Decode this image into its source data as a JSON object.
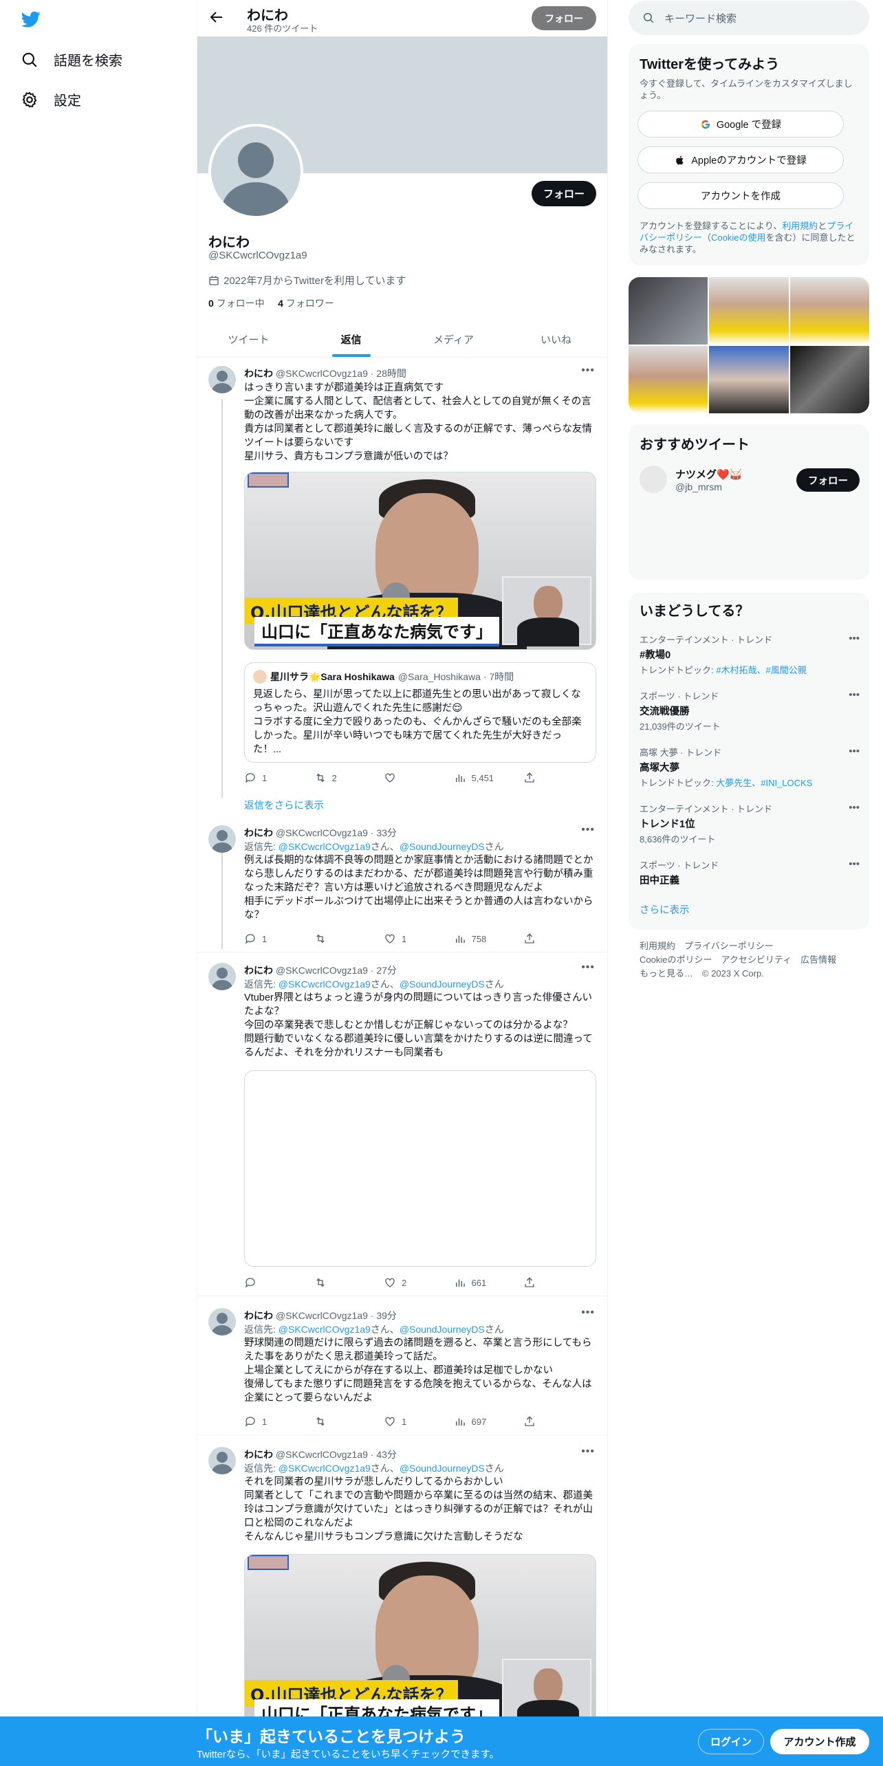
{
  "nav": {
    "explore_label": "話題を検索",
    "settings_label": "設定"
  },
  "header": {
    "name": "わにわ",
    "tweet_count": "426 件のツイート",
    "follow_label": "フォロー"
  },
  "profile": {
    "name": "わにわ",
    "handle": "@SKCwcrlCOvgz1a9",
    "joined": "2022年7月からTwitterを利用しています",
    "following_count": "0",
    "following_label": " フォロー中",
    "followers_count": "4",
    "followers_label": " フォロワー",
    "follow_label": "フォロー"
  },
  "tabs": [
    "ツイート",
    "返信",
    "メディア",
    "いいね"
  ],
  "tweets": [
    {
      "name": "わにわ",
      "meta": "@SKCwcrlCOvgz1a9 · 28時間",
      "text": "はっきり言いますが郡道美玲は正直病気です\n一企業に属する人間として、配信者として、社会人としての自覚が無くその言動の改善が出来なかった病人です。\n貴方は同業者として郡道美玲に厳しく言及するのが正解です、薄っぺらな友情ツイートは要らないです\n星川サラ、貴方もコンプラ意識が低いのでは？",
      "media_caption_1": "Q.山口達也とどんな話を？",
      "media_caption_2": "山口に「正直あなた病気です」",
      "quote": {
        "name": "星川サラ🌟Sara Hoshikawa",
        "meta": "@Sara_Hoshikawa · 7時間",
        "text": "見返したら、星川が思ってた以上に郡道先生との思い出があって寂しくなっちゃった。沢山遊んでくれた先生に感謝だ😌\nコラボする度に全力で殴りあったのも、ぐんかんざらで騒いだのも全部楽しかった。星川が辛い時いつでも味方で居てくれた先生が大好きだった！..."
      },
      "replies": "1",
      "retweets": "2",
      "likes": "",
      "views": "5,451"
    },
    {
      "name": "わにわ",
      "meta": "@SKCwcrlCOvgz1a9 · 33分",
      "reply_prefix": "返信先: ",
      "reply_user1": "@SKCwcrlCOvgz1a9",
      "reply_mid": "さん、",
      "reply_user2": "@SoundJourneyDS",
      "reply_suffix": "さん",
      "text": "例えば長期的な体調不良等の問題とか家庭事情とか活動における諸問題でとかなら悲しんだりするのはまだわかる、だが郡道美玲は問題発言や行動が積み重なった末路だぞ？言い方は悪いけど追放されるべき問題児なんだよ\n相手にデッドボールぶつけて出場停止に出来そうとか普通の人は言わないからな？",
      "replies": "1",
      "retweets": "",
      "likes": "1",
      "views": "758"
    },
    {
      "name": "わにわ",
      "meta": "@SKCwcrlCOvgz1a9 · 27分",
      "reply_prefix": "返信先: ",
      "reply_user1": "@SKCwcrlCOvgz1a9",
      "reply_mid": "さん、",
      "reply_user2": "@SoundJourneyDS",
      "reply_suffix": "さん",
      "text": "Vtuber界隈とはちょっと違うが身内の問題についてはっきり言った俳優さんいたよな？\n今回の卒業発表で悲しむとか惜しむが正解じゃないってのは分かるよな？\n問題行動でいなくなる郡道美玲に優しい言葉をかけたりするのは逆に間違ってるんだよ、それを分かれリスナーも同業者も",
      "replies": "",
      "retweets": "",
      "likes": "2",
      "views": "661"
    },
    {
      "name": "わにわ",
      "meta": "@SKCwcrlCOvgz1a9 · 39分",
      "reply_prefix": "返信先: ",
      "reply_user1": "@SKCwcrlCOvgz1a9",
      "reply_mid": "さん、",
      "reply_user2": "@SoundJourneyDS",
      "reply_suffix": "さん",
      "text": "野球関連の問題だけに限らず過去の諸問題を遡ると、卒業と言う形にしてもらえた事をありがたく思え郡道美玲って話だ。\n上場企業としてえにからが存在する以上、郡道美玲は足枷でしかない\n復帰してもまた懲りずに問題発言をする危険を抱えているからな、そんな人は企業にとって要らないんだよ",
      "replies": "1",
      "retweets": "",
      "likes": "1",
      "views": "697"
    },
    {
      "name": "わにわ",
      "meta": "@SKCwcrlCOvgz1a9 · 43分",
      "reply_prefix": "返信先: ",
      "reply_user1": "@SKCwcrlCOvgz1a9",
      "reply_mid": "さん、",
      "reply_user2": "@SoundJourneyDS",
      "reply_suffix": "さん",
      "text": "それを同業者の星川サラが悲しんだりしてるからおかしい\n同業者として「これまでの言動や問題から卒業に至るのは当然の結末、郡道美玲はコンプラ意識が欠けていた」とはっきり糾弾するのが正解では？それが山口と松岡のこれなんだよ\nそんなんじゃ星川サラもコンプラ意識に欠けた言動しそうだな",
      "media_caption_1": "Q.山口達也とどんな話を？",
      "media_caption_2": "山口に「正直あなた病気です」"
    }
  ],
  "show_more_replies": "返信をさらに表示",
  "sidebar": {
    "search_placeholder": "キーワード検索",
    "signup_title": "Twitterを使ってみよう",
    "signup_sub": "今すぐ登録して、タイムラインをカスタマイズしましょう。",
    "google_label": "Google で登録",
    "apple_label": "Appleのアカウントで登録",
    "create_label": "アカウントを作成",
    "terms_1": "アカウントを登録することにより、",
    "terms_link1": "利用規約",
    "terms_2": "と",
    "terms_link2": "プライバシーポリシー",
    "terms_3": "（",
    "terms_link3": "Cookieの使用",
    "terms_4": "を含む）に同意したとみなされます。",
    "recommended_title": "おすすめツイート",
    "rec_name": "ナツメグ❤️🥁",
    "rec_handle": "@jb_mrsm",
    "rec_follow": "フォロー",
    "trends_title": "いまどうしてる？",
    "trends": [
      {
        "cat": "エンターテインメント · トレンド",
        "name": "#教場0",
        "sub_prefix": "トレンドトピック: ",
        "sub_links": "#木村拓哉、#風間公親"
      },
      {
        "cat": "スポーツ · トレンド",
        "name": "交流戦優勝",
        "sub_prefix": "21,039件のツイート",
        "sub_links": ""
      },
      {
        "cat": "高塚 大夢 · トレンド",
        "name": "高塚大夢",
        "sub_prefix": "トレンドトピック: ",
        "sub_links": "大夢先生、#INI_LOCKS"
      },
      {
        "cat": "エンターテインメント · トレンド",
        "name": "トレンド1位",
        "sub_prefix": "8,636件のツイート",
        "sub_links": ""
      },
      {
        "cat": "スポーツ · トレンド",
        "name": "田中正義",
        "sub_prefix": "",
        "sub_links": ""
      }
    ],
    "show_more": "さらに表示",
    "footer_line1": "利用規約　プライバシーポリシー",
    "footer_line2": "Cookieのポリシー　アクセシビリティ　広告情報",
    "footer_line3": "もっと見る…　© 2023 X Corp."
  },
  "bottom": {
    "title": "「いま」起きていることを見つけよう",
    "sub": "Twitterなら、「いま」起きていることをいち早くチェックできます。",
    "login": "ログイン",
    "signup": "アカウント作成"
  }
}
